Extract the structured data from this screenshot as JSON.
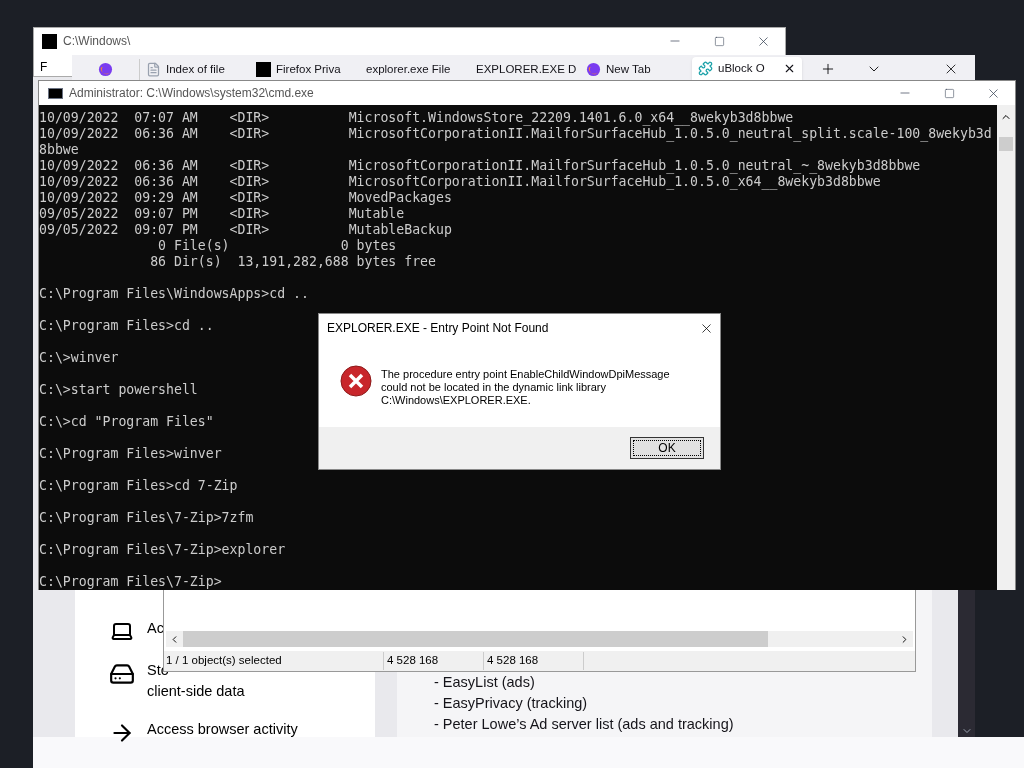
{
  "sevenzip": {
    "title": "C:\\Windows\\",
    "menu_first": "F",
    "status": [
      "1 / 1 object(s) selected",
      "4 528 168",
      "4 528 168"
    ]
  },
  "browser": {
    "tabs": [
      {
        "label": "Index of file",
        "kind": "page",
        "selected": false
      },
      {
        "label": "Firefox Priva",
        "kind": "square",
        "selected": false
      },
      {
        "label": "explorer.exe File",
        "kind": "plain",
        "selected": false
      },
      {
        "label": "EXPLORER.EXE D",
        "kind": "plain",
        "selected": false
      },
      {
        "label": "New Tab",
        "kind": "globe",
        "selected": false
      },
      {
        "label": "uBlock O",
        "kind": "puzzle",
        "selected": true
      }
    ],
    "items": [
      {
        "kind": "laptop",
        "lines": [
          "Ac"
        ]
      },
      {
        "kind": "drive",
        "lines": [
          "Sto",
          "client-side data"
        ]
      },
      {
        "kind": "arrow",
        "lines": [
          "Access browser activity"
        ]
      }
    ],
    "lists": [
      "- EasyList (ads)",
      "- EasyPrivacy (tracking)",
      "- Peter Lowe’s Ad server list (ads and tracking)"
    ]
  },
  "cmd": {
    "title": "Administrator: C:\\Windows\\system32\\cmd.exe",
    "output": [
      "10/09/2022  07:07 AM    <DIR>          Microsoft.WindowsStore_22209.1401.6.0_x64__8wekyb3d8bbwe",
      "10/09/2022  06:36 AM    <DIR>          MicrosoftCorporationII.MailforSurfaceHub_1.0.5.0_neutral_split.scale-100_8wekyb3d",
      "8bbwe",
      "10/09/2022  06:36 AM    <DIR>          MicrosoftCorporationII.MailforSurfaceHub_1.0.5.0_neutral_~_8wekyb3d8bbwe",
      "10/09/2022  06:36 AM    <DIR>          MicrosoftCorporationII.MailforSurfaceHub_1.0.5.0_x64__8wekyb3d8bbwe",
      "10/09/2022  09:29 AM    <DIR>          MovedPackages",
      "09/05/2022  09:07 PM    <DIR>          Mutable",
      "09/05/2022  09:07 PM    <DIR>          MutableBackup",
      "               0 File(s)              0 bytes",
      "              86 Dir(s)  13,191,282,688 bytes free"
    ],
    "prompts": [
      "C:\\Program Files\\WindowsApps>cd ..",
      "C:\\Program Files>cd ..",
      "C:\\>winver",
      "C:\\>start powershell",
      "C:\\>cd \"Program Files\"",
      "C:\\Program Files>winver",
      "C:\\Program Files>cd 7-Zip",
      "C:\\Program Files\\7-Zip>7zfm",
      "C:\\Program Files\\7-Zip>explorer",
      "C:\\Program Files\\7-Zip>"
    ]
  },
  "dialog": {
    "title": "EXPLORER.EXE - Entry Point Not Found",
    "message": [
      "The procedure entry point EnableChildWindowDpiMessage",
      "could not be located in the dynamic link library",
      "C:\\Windows\\EXPLORER.EXE."
    ],
    "button": "OK"
  }
}
